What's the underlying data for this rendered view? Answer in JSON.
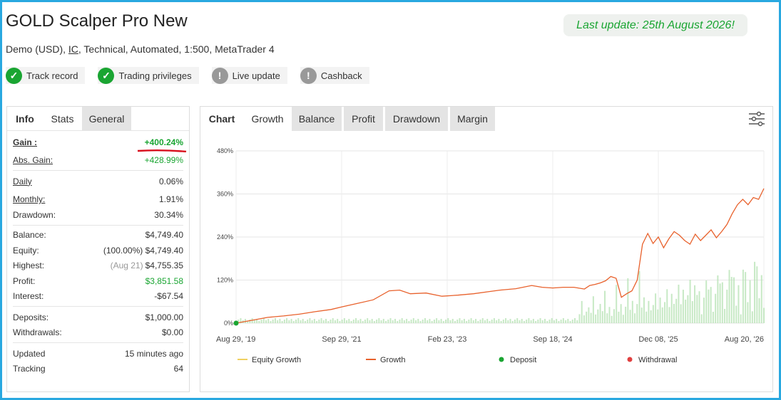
{
  "header": {
    "title": "GOLD Scalper Pro New",
    "subtitle_pre": "Demo (USD), ",
    "subtitle_link": "IC",
    "subtitle_post": ", Technical, Automated, 1:500, MetaTrader 4",
    "last_update": "Last update: 25th August 2026!"
  },
  "badges": [
    {
      "label": "Track record",
      "icon": "check-icon",
      "state": "ok"
    },
    {
      "label": "Trading privileges",
      "icon": "check-icon",
      "state": "ok"
    },
    {
      "label": "Live update",
      "icon": "exclamation-icon",
      "state": "warn"
    },
    {
      "label": "Cashback",
      "icon": "exclamation-icon",
      "state": "warn"
    }
  ],
  "left_tabs": [
    "Info",
    "Stats",
    "General"
  ],
  "stats": {
    "gain": {
      "label": "Gain :",
      "value": "+400.24%"
    },
    "abs_gain": {
      "label": "Abs. Gain:",
      "value": "+428.99%"
    },
    "daily": {
      "label": "Daily",
      "value": "0.06%"
    },
    "monthly": {
      "label": "Monthly:",
      "value": "1.91%"
    },
    "drawdown": {
      "label": "Drawdown:",
      "value": "30.34%"
    },
    "balance": {
      "label": "Balance:",
      "value": "$4,749.40"
    },
    "equity": {
      "label": "Equity:",
      "prefix": "(100.00%)",
      "value": "$4,749.40"
    },
    "highest": {
      "label": "Highest:",
      "prefix": "(Aug 21)",
      "value": "$4,755.35"
    },
    "profit": {
      "label": "Profit:",
      "value": "$3,851.58"
    },
    "interest": {
      "label": "Interest:",
      "value": "-$67.54"
    },
    "deposits": {
      "label": "Deposits:",
      "value": "$1,000.00"
    },
    "withdrawals": {
      "label": "Withdrawals:",
      "value": "$0.00"
    },
    "updated": {
      "label": "Updated",
      "value": "15 minutes ago"
    },
    "tracking": {
      "label": "Tracking",
      "value": "64"
    }
  },
  "chart_tabs": [
    "Chart",
    "Growth",
    "Balance",
    "Profit",
    "Drawdown",
    "Margin"
  ],
  "colors": {
    "green": "#1aa532",
    "growth_line": "#e8612c",
    "bars": "#b9e3b6",
    "deposit": "#1aa532",
    "withdrawal": "#e04040",
    "equity": "#f0d060"
  },
  "chart_data": {
    "type": "line",
    "yticks": [
      "0%",
      "120%",
      "240%",
      "360%",
      "480%"
    ],
    "ylim": [
      0,
      480
    ],
    "xticks": [
      "Aug 29, '19",
      "Sep 29, '21",
      "Feb 23, '23",
      "Sep 18, '24",
      "Dec 08, '25",
      "Aug 20, '26"
    ],
    "series": [
      {
        "name": "Growth",
        "x": [
          0,
          0.03,
          0.06,
          0.09,
          0.12,
          0.15,
          0.18,
          0.2,
          0.23,
          0.26,
          0.29,
          0.31,
          0.33,
          0.36,
          0.39,
          0.42,
          0.45,
          0.48,
          0.5,
          0.53,
          0.56,
          0.58,
          0.6,
          0.62,
          0.64,
          0.66,
          0.67,
          0.68,
          0.69,
          0.7,
          0.71,
          0.72,
          0.73,
          0.74,
          0.75,
          0.76,
          0.77,
          0.78,
          0.79,
          0.8,
          0.81,
          0.82,
          0.83,
          0.84,
          0.85,
          0.86,
          0.87,
          0.88,
          0.89,
          0.9,
          0.91,
          0.92,
          0.93,
          0.94,
          0.95,
          0.96,
          0.97,
          0.98,
          0.99,
          1.0
        ],
        "y": [
          0,
          8,
          16,
          20,
          25,
          32,
          38,
          45,
          55,
          65,
          90,
          92,
          82,
          84,
          75,
          78,
          82,
          88,
          92,
          96,
          105,
          100,
          98,
          100,
          100,
          95,
          105,
          108,
          112,
          118,
          130,
          125,
          72,
          82,
          90,
          120,
          220,
          250,
          222,
          240,
          210,
          235,
          255,
          245,
          230,
          220,
          248,
          230,
          245,
          260,
          238,
          255,
          275,
          305,
          330,
          345,
          330,
          350,
          345,
          375
        ]
      },
      {
        "name": "Equity Growth",
        "x": [],
        "y": []
      }
    ],
    "legend": [
      "Equity Growth",
      "Growth",
      "Deposit",
      "Withdrawal"
    ],
    "legend_position": "bottom",
    "grid": true
  }
}
